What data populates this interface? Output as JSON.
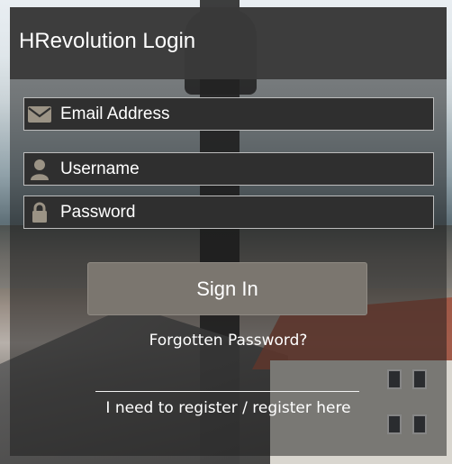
{
  "login": {
    "title": "HRevolution Login",
    "fields": {
      "email": {
        "label": "Email Address",
        "icon": "envelope-icon"
      },
      "username": {
        "label": "Username",
        "icon": "user-icon"
      },
      "password": {
        "label": "Password",
        "icon": "lock-icon"
      }
    },
    "sign_in_label": "Sign In",
    "forgot_label": "Forgotten Password?",
    "register_label": "I need to register / register here"
  },
  "colors": {
    "panel_overlay": "#191919",
    "header": "#3a3a3a",
    "field_bg": "#2f2f2f",
    "field_border": "#bdbdbd",
    "icon_tan": "#9b9385",
    "button": "#7b766f",
    "text": "#ffffff"
  }
}
